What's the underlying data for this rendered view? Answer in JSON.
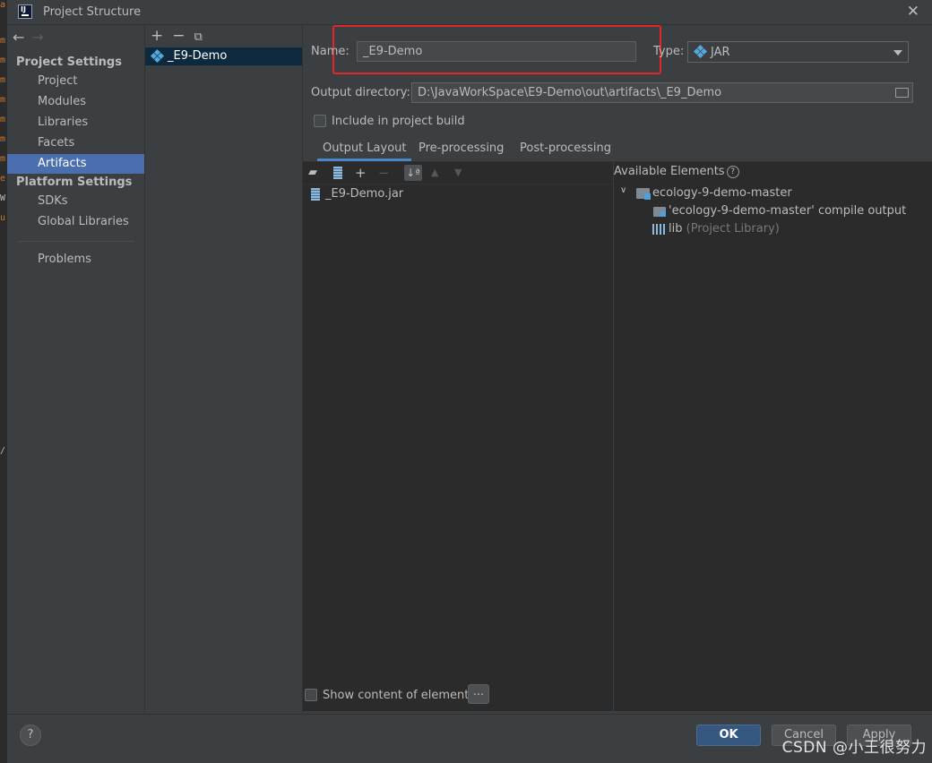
{
  "window": {
    "title": "Project Structure"
  },
  "nav": {
    "project_settings_header": "Project Settings",
    "items_top": [
      "Project",
      "Modules",
      "Libraries",
      "Facets",
      "Artifacts"
    ],
    "platform_settings_header": "Platform Settings",
    "items_platform": [
      "SDKs",
      "Global Libraries"
    ],
    "problems": "Problems",
    "selected": "Artifacts"
  },
  "artifacts_list": {
    "items": [
      "_E9-Demo"
    ]
  },
  "form": {
    "name_label": "Name:",
    "name_value": "_E9-Demo",
    "type_label": "Type:",
    "type_value": "JAR",
    "output_dir_label": "Output directory:",
    "output_dir_value": "D:\\JavaWorkSpace\\E9-Demo\\out\\artifacts\\_E9_Demo",
    "include_build_label": "Include in project build",
    "include_build_checked": false
  },
  "tabs": [
    "Output Layout",
    "Pre-processing",
    "Post-processing"
  ],
  "output_layout": {
    "items": [
      "_E9-Demo.jar"
    ]
  },
  "available": {
    "header": "Available Elements",
    "module": "ecology-9-demo-master",
    "compile_output": "'ecology-9-demo-master' compile output",
    "lib_name": "lib",
    "lib_suffix": "(Project Library)"
  },
  "show_content": {
    "label": "Show content of elements",
    "checked": false,
    "more": "..."
  },
  "buttons": {
    "ok": "OK",
    "cancel": "Cancel",
    "apply": "Apply",
    "help": "?"
  },
  "watermark": "CSDN @小王很努力",
  "colors": {
    "selection": "#4b6eaf",
    "annotation": "#e3262a",
    "primary_button": "#365880"
  }
}
